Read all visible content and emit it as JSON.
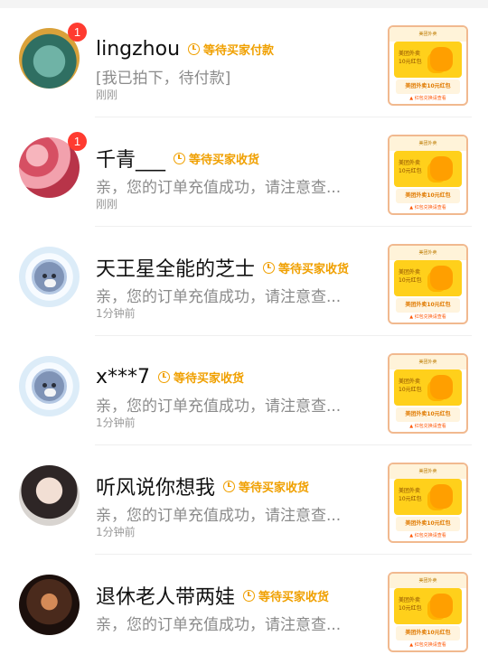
{
  "conversations": [
    {
      "name": "lingzhou",
      "status": "等待买家付款",
      "message": "[我已拍下，待付款]",
      "time": "刚刚",
      "unread": "1",
      "avatar": "app-avatar"
    },
    {
      "name": "千青___",
      "status": "等待买家收货",
      "message": "亲，您的订单充值成功，请注意查...",
      "time": "刚刚",
      "unread": "1",
      "avatar": "flower-avatar"
    },
    {
      "name": "天王星全能的芝士",
      "status": "等待买家收货",
      "message": "亲，您的订单充值成功，请注意查...",
      "time": "1分钟前",
      "unread": "",
      "avatar": "seal-avatar"
    },
    {
      "name": "x***7",
      "status": "等待买家收货",
      "message": "亲，您的订单充值成功，请注意查...",
      "time": "1分钟前",
      "unread": "",
      "avatar": "seal-avatar"
    },
    {
      "name": "听风说你想我",
      "status": "等待买家收货",
      "message": "亲，您的订单充值成功，请注意查...",
      "time": "1分钟前",
      "unread": "",
      "avatar": "portrait-avatar"
    },
    {
      "name": "退休老人带两娃",
      "status": "等待买家收货",
      "message": "亲，您的订单充值成功，请注意查...",
      "time": "",
      "unread": "",
      "avatar": "dark-portrait-avatar"
    }
  ],
  "product_card": {
    "top": "美团外卖",
    "line1": "美团外卖",
    "line2": "10元红包",
    "bottom": "美团外卖10元红包",
    "note": "▲ 红包兑换请查看"
  }
}
